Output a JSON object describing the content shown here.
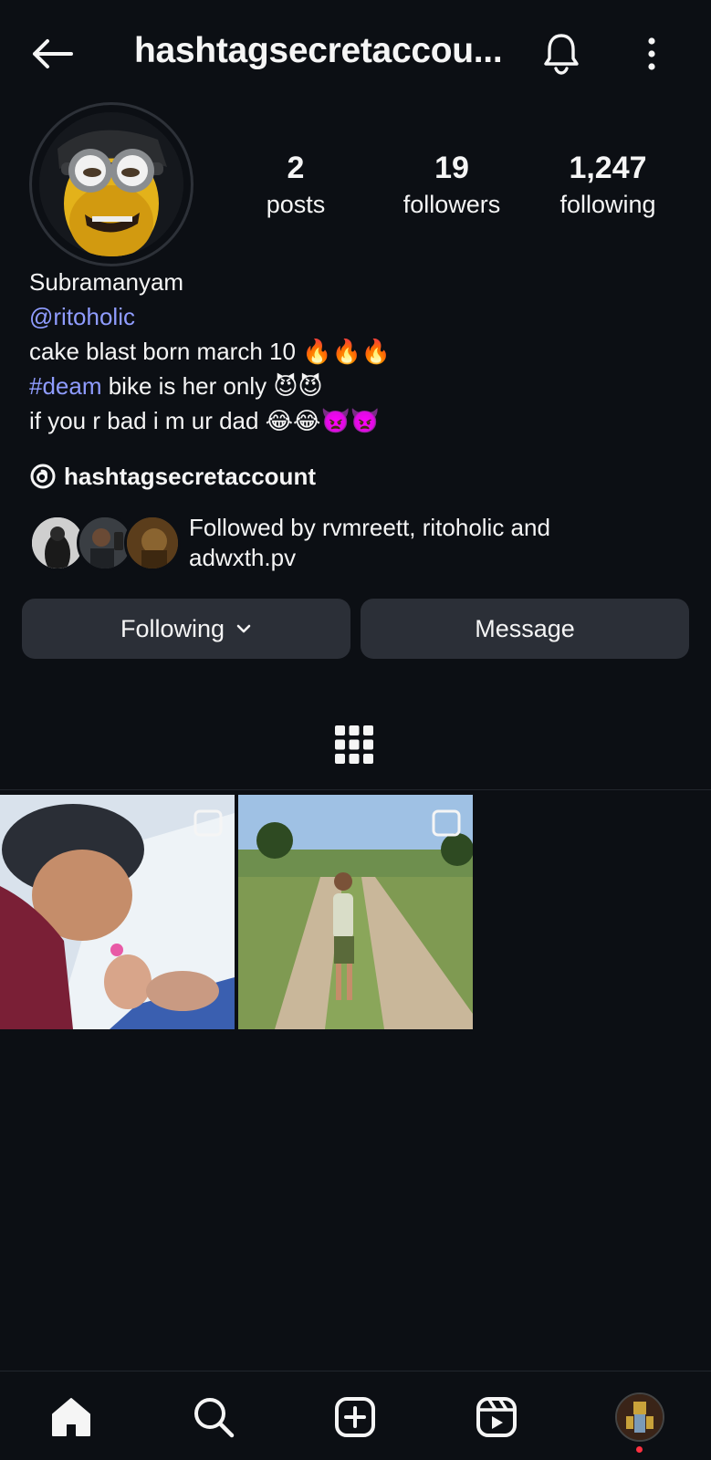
{
  "header": {
    "title": "hashtagsecretaccou...",
    "back_icon": "arrow-left-icon",
    "bell_icon": "bell-icon",
    "more_icon": "more-vertical-icon"
  },
  "profile": {
    "stats": {
      "posts_count": "2",
      "posts_label": "posts",
      "followers_count": "19",
      "followers_label": "followers",
      "following_count": "1,247",
      "following_label": "following"
    },
    "name": "Subramanyam",
    "mention": "@ritoholic",
    "bio_line1": "cake blast born march 10 🔥🔥🔥",
    "bio_hashtag": "#deam",
    "bio_line2_rest": " bike is her only 😈😈",
    "bio_line3": "if you r bad i m ur dad 😂😂👿👿",
    "threads_handle": "hashtagsecretaccount",
    "followed_by": "Followed by rvmreett, ritoholic and adwxth.pv"
  },
  "actions": {
    "following_label": "Following",
    "message_label": "Message"
  },
  "colors": {
    "background": "#0c0f14",
    "button_bg": "#2b2f37",
    "link": "#8f9cff",
    "notification_dot": "#ff3040"
  },
  "nav": {
    "items": [
      "home-icon",
      "search-icon",
      "create-icon",
      "reels-icon",
      "profile-avatar"
    ]
  }
}
